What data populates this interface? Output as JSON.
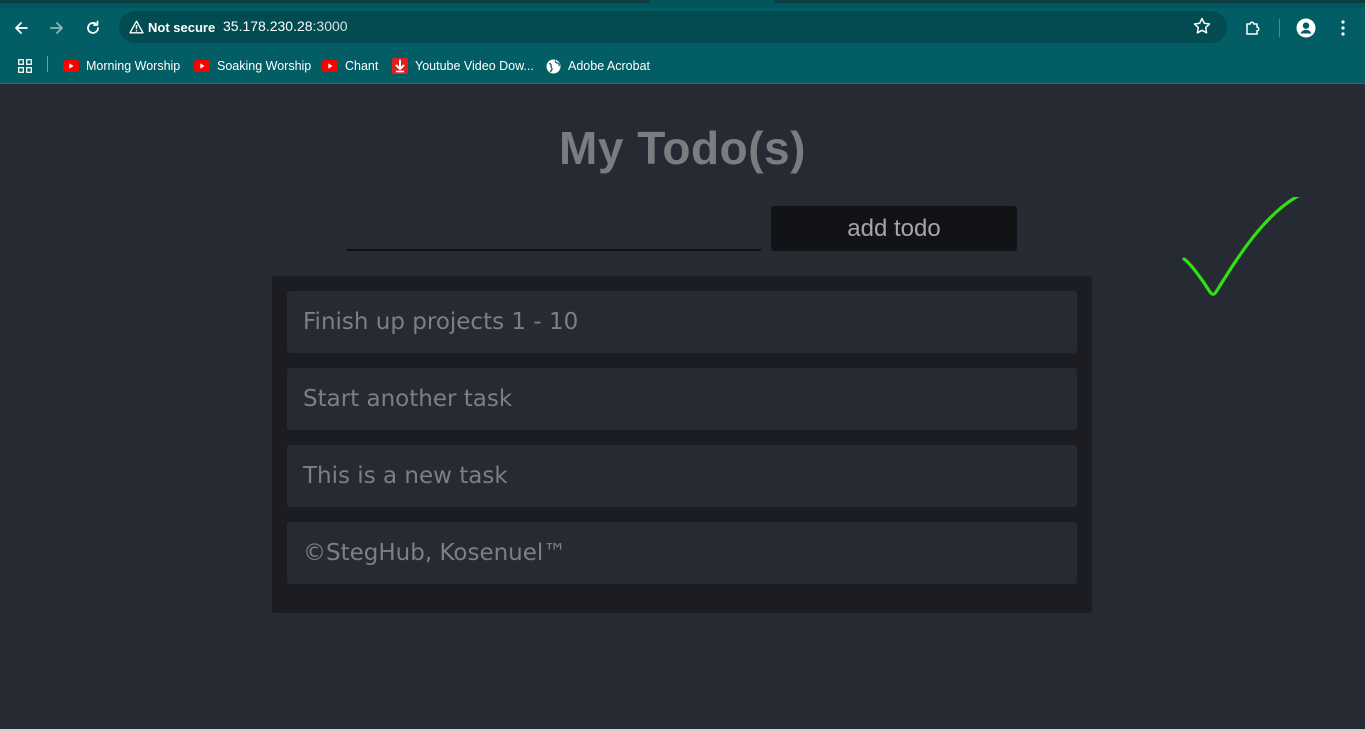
{
  "browser": {
    "security_label": "Not secure",
    "url_host": "35.178.230.28",
    "url_port": ":3000",
    "bookmarks": [
      {
        "label": "Morning Worship",
        "icon": "youtube-icon"
      },
      {
        "label": "Soaking Worship",
        "icon": "youtube-icon"
      },
      {
        "label": "Chant",
        "icon": "youtube-icon"
      },
      {
        "label": "Youtube Video Dow...",
        "icon": "download-icon"
      },
      {
        "label": "Adobe Acrobat",
        "icon": "globe-icon"
      }
    ],
    "colors": {
      "toolbar": "#035d64",
      "omnibox": "#024b51"
    }
  },
  "app": {
    "title": "My Todo(s)",
    "input": {
      "value": "",
      "placeholder": ""
    },
    "add_button_label": "add todo",
    "todos": [
      {
        "text": "Finish up projects 1 - 10"
      },
      {
        "text": "Start another task"
      },
      {
        "text": "This is a new task"
      },
      {
        "text": "©StegHub, Kosenuel™"
      }
    ],
    "colors": {
      "background": "#262a33",
      "panel": "#1b1d22",
      "item": "#272a33",
      "checkmark": "#2fe012"
    }
  }
}
